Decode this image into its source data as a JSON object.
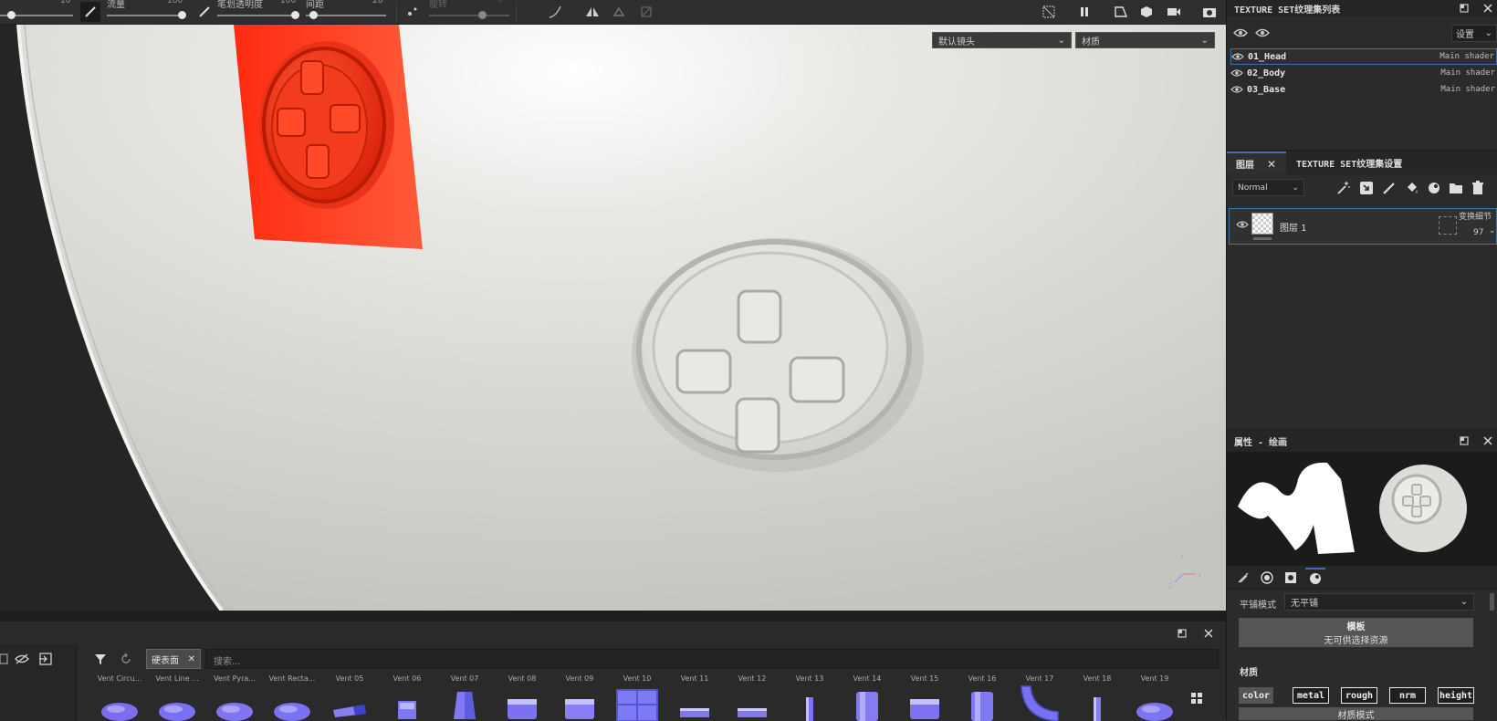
{
  "toolbar": {
    "slider1": {
      "value": "10"
    },
    "slider2": {
      "label": "流量",
      "value": "100"
    },
    "slider3": {
      "label": "笔划透明度",
      "value": "100"
    },
    "slider4": {
      "label": "间距",
      "value": "20"
    },
    "slider5": {
      "label": "旋转",
      "value": "0"
    }
  },
  "viewport": {
    "camera_select": "默认镜头",
    "material_select": "材质"
  },
  "texture_sets": {
    "title": "TEXTURE SET纹理集列表",
    "settings_label": "设置",
    "items": [
      {
        "name": "01_Head",
        "shader": "Main shader",
        "selected": true
      },
      {
        "name": "02_Body",
        "shader": "Main shader",
        "selected": false
      },
      {
        "name": "03_Base",
        "shader": "Main shader",
        "selected": false
      }
    ]
  },
  "layers": {
    "tab_layers": "图层",
    "tab_settings": "TEXTURE SET纹理集设置",
    "blend_mode": "Normal",
    "items": [
      {
        "name": "图层 1",
        "blend_label": "变换细节",
        "opacity": "97"
      }
    ]
  },
  "properties": {
    "title": "属性 - 绘画",
    "tiling_label": "平铺模式",
    "tiling_value": "无平铺",
    "template_title": "模板",
    "template_subtitle": "无可供选择资源",
    "material_label": "材质",
    "channels": [
      "color",
      "metal",
      "rough",
      "nrm",
      "height"
    ],
    "material_mode_label": "材质模式"
  },
  "shelf": {
    "filter_tag": "硬表面",
    "search_placeholder": "搜索...",
    "items": [
      {
        "label": "Vent Circu...",
        "color": "#7b6cf0"
      },
      {
        "label": "Vent Line ...",
        "color": "#7a70f5"
      },
      {
        "label": "Vent Pyra...",
        "color": "#7f75f2"
      },
      {
        "label": "Vent Recta...",
        "color": "#7a72f2"
      },
      {
        "label": "Vent 05",
        "color": "#8b7df2"
      },
      {
        "label": "Vent 06",
        "color": "#7d78f2"
      },
      {
        "label": "Vent 07",
        "color": "#8577f3"
      },
      {
        "label": "Vent 08",
        "color": "#7b72f2"
      },
      {
        "label": "Vent 09",
        "color": "#8a7ef4"
      },
      {
        "label": "Vent 10",
        "color": "#7f7af4"
      },
      {
        "label": "Vent 11",
        "color": "#7d77f2"
      },
      {
        "label": "Vent 12",
        "color": "#8076f3"
      },
      {
        "label": "Vent 13",
        "color": "#7b72f0"
      },
      {
        "label": "Vent 14",
        "color": "#857cf2"
      },
      {
        "label": "Vent 15",
        "color": "#7d73f1"
      },
      {
        "label": "Vent 16",
        "color": "#8179f2"
      },
      {
        "label": "Vent 17",
        "color": "#7a70f0"
      },
      {
        "label": "Vent 18",
        "color": "#857af2"
      },
      {
        "label": "Vent 19",
        "color": "#7c74f1"
      }
    ]
  },
  "colors": {
    "accent": "#3f6fb0",
    "red_patch": "#ff3c1c",
    "sphere": "#d7d7d3"
  }
}
